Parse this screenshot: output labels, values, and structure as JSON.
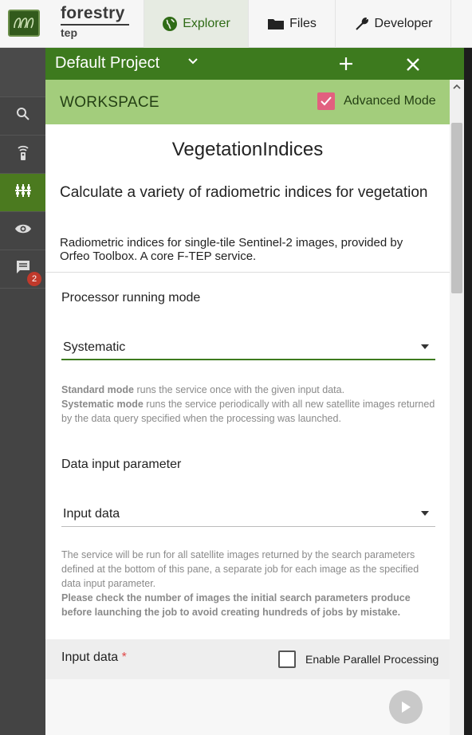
{
  "app": {
    "brand_name": "forestry",
    "brand_sub": "tep"
  },
  "nav": {
    "tabs": [
      {
        "label": "Explorer",
        "icon": "globe-icon",
        "active": true
      },
      {
        "label": "Files",
        "icon": "folder-icon",
        "active": false
      },
      {
        "label": "Developer",
        "icon": "wrench-icon",
        "active": false
      }
    ]
  },
  "rail": {
    "items": [
      {
        "icon": "search-icon"
      },
      {
        "icon": "remote-icon"
      },
      {
        "icon": "services-icon",
        "active": true
      },
      {
        "icon": "eye-icon"
      },
      {
        "icon": "messages-icon",
        "badge": "2"
      }
    ]
  },
  "panel": {
    "project_title": "Default Project",
    "workspace_title": "WORKSPACE",
    "advanced_mode_label": "Advanced Mode",
    "advanced_mode_checked": true
  },
  "service": {
    "name": "VegetationIndices",
    "title": "Calculate a variety of radiometric indices for vegetation",
    "description": "Radiometric indices for single-tile Sentinel-2 images, provided by Orfeo Toolbox. A core F-TEP service."
  },
  "running_mode": {
    "label": "Processor running mode",
    "selected": "Systematic",
    "help_standard_bold": "Standard mode",
    "help_standard": " runs the service once with the given input data.",
    "help_systematic_bold": "Systematic mode",
    "help_systematic": " runs the service periodically with all new satellite images returned by the data query specified when the processing was launched."
  },
  "data_input": {
    "label": "Data input parameter",
    "selected": "Input data",
    "help": "The service will be run for all satellite images returned by the search parameters defined at the bottom of this pane, a separate job for each image as the specified data input parameter.",
    "help_bold": "Please check the number of images the initial search parameters produce before launching the job to avoid creating hundreds of jobs by mistake."
  },
  "input_data": {
    "label": "Input data",
    "required_mark": "*",
    "parallel_label": "Enable Parallel Processing",
    "parallel_checked": false
  },
  "colors": {
    "header_green": "#3d7a1e",
    "workspace_green": "#a3cd7c",
    "checkbox_pink": "#e2607f",
    "rail_dark": "#444444"
  }
}
